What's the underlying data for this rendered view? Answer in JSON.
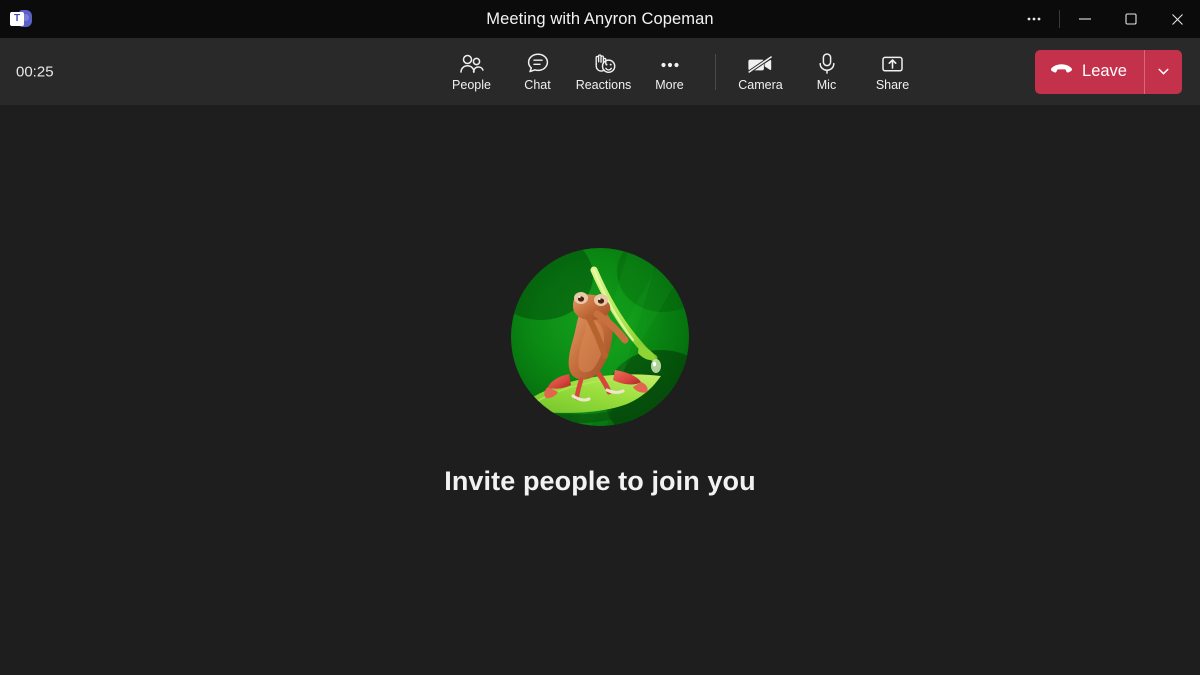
{
  "window": {
    "title": "Meeting with Anyron Copeman",
    "app_icon": "teams-logo-icon",
    "logo_letter": "T",
    "controls": {
      "more": "•••",
      "minimize": "minimize-icon",
      "maximize": "maximize-icon",
      "close": "close-icon"
    }
  },
  "toolbar": {
    "timer": "00:25",
    "items": [
      {
        "label": "People",
        "icon": "people-icon"
      },
      {
        "label": "Chat",
        "icon": "chat-icon"
      },
      {
        "label": "Reactions",
        "icon": "reactions-icon"
      },
      {
        "label": "More",
        "icon": "more-ellipsis-icon"
      },
      {
        "label": "Camera",
        "icon": "camera-off-icon"
      },
      {
        "label": "Mic",
        "icon": "microphone-icon"
      },
      {
        "label": "Share",
        "icon": "share-screen-icon"
      }
    ],
    "leave": {
      "label": "Leave",
      "icon": "hangup-phone-icon",
      "caret": "chevron-down-icon",
      "color": "#c4314b"
    }
  },
  "stage": {
    "avatar_alt": "red-eyed tree frog holding a blade of grass on green leaf",
    "invite_text": "Invite people to join you",
    "background": "#1e1e1e"
  }
}
